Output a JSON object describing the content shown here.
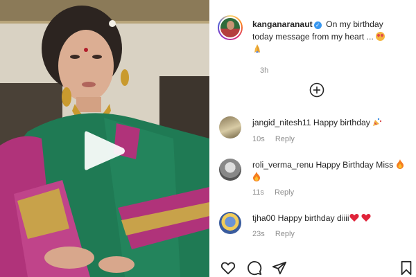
{
  "post": {
    "media": {
      "type": "video"
    },
    "caption": {
      "username": "kanganaranaut",
      "verified": true,
      "text_line1": "On my birthday",
      "text_line2": "today message from my heart ...",
      "time": "3h"
    },
    "comments": [
      {
        "username": "jangid_nitesh11",
        "text": "Happy birthday",
        "time": "10s",
        "reply_label": "Reply",
        "emoji": "party-popper-icon"
      },
      {
        "username": "roli_verma_renu",
        "text": "Happy Birthday Miss",
        "time": "11s",
        "reply_label": "Reply",
        "emoji": "fire-icon"
      },
      {
        "username": "tjha00",
        "text": "Happy birthday diiii",
        "time": "23s",
        "reply_label": "Reply",
        "emoji": "red-heart-icon"
      }
    ],
    "actions": [
      "like-icon",
      "comment-icon",
      "share-icon",
      "save-icon"
    ]
  },
  "colors": {
    "text": "#262626",
    "muted": "#8e8e8e",
    "verified": "#3897f0",
    "heart": "#e0243a",
    "fire": "#f57c1f"
  }
}
